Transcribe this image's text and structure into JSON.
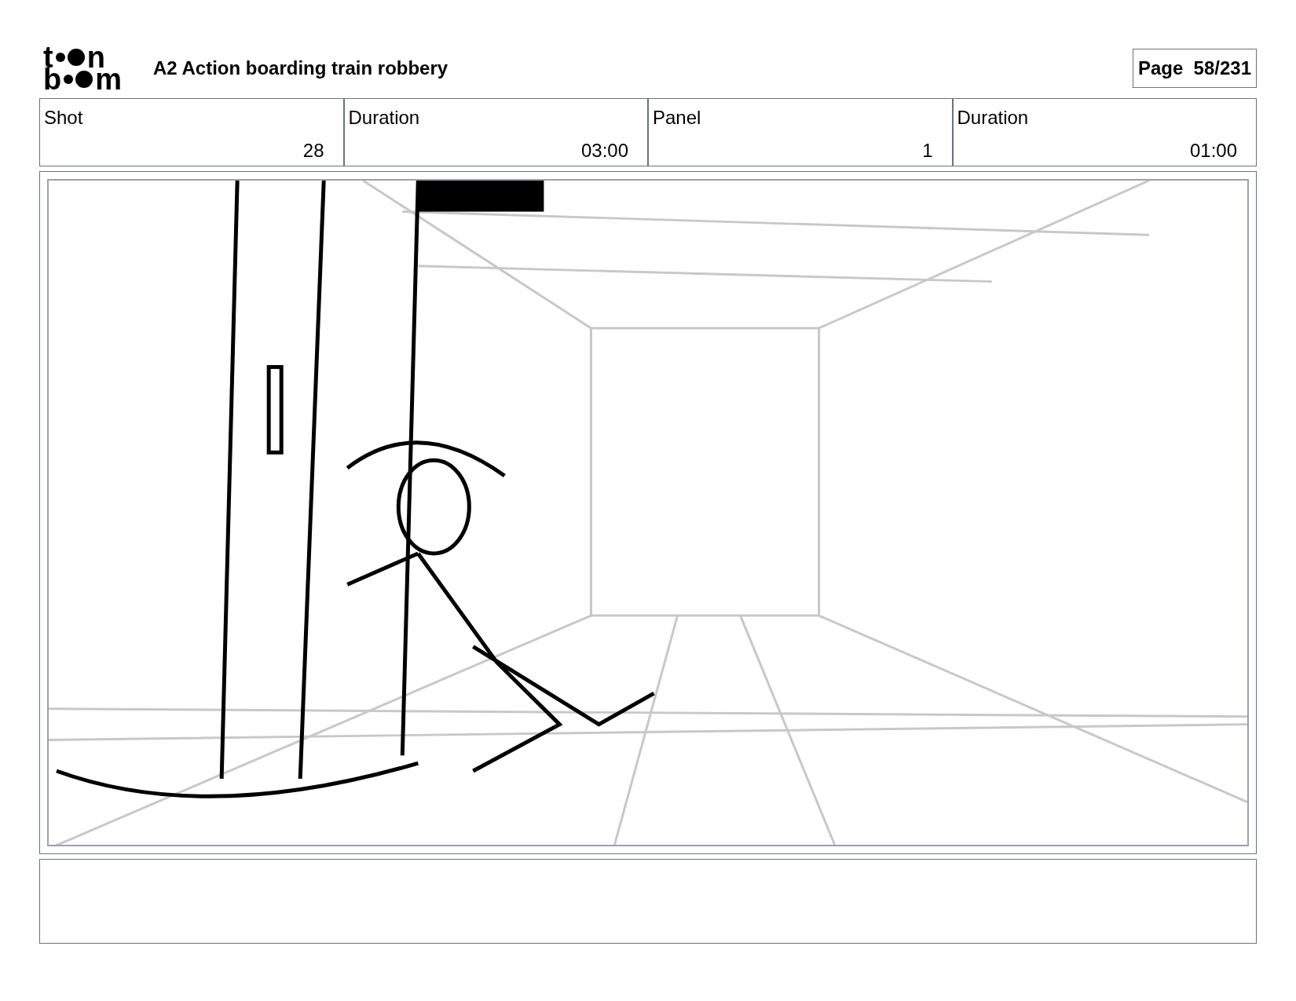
{
  "logo": {
    "top": [
      "t",
      "n"
    ],
    "bottom": [
      "b",
      "m"
    ]
  },
  "title": "A2 Action boarding train robbery",
  "page": "Page  58/231",
  "fields": [
    {
      "label": "Shot",
      "value": "28"
    },
    {
      "label": "Duration",
      "value": "03:00"
    },
    {
      "label": "Panel",
      "value": "1"
    },
    {
      "label": "Duration",
      "value": "01:00"
    }
  ]
}
